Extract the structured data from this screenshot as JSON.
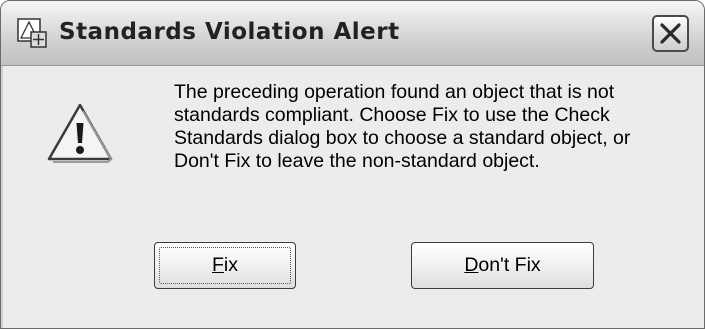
{
  "window": {
    "title": "Standards Violation Alert",
    "app_icon": "autocad-standards-icon",
    "close_icon": "close-icon"
  },
  "alert": {
    "icon": "warning-icon",
    "message_lines": [
      "The preceding operation found an object that is not",
      "standards compliant. Choose Fix to use the Check",
      "Standards dialog box to choose a standard object, or",
      "Don't Fix to leave the non-standard object."
    ]
  },
  "buttons": {
    "fix": {
      "mnemonic": "F",
      "rest": "ix"
    },
    "dont_fix": {
      "mnemonic": "D",
      "rest": "on't Fix"
    }
  },
  "colors": {
    "dialog_background": "#ececec",
    "warning_fill": "#f4f4f4",
    "warning_stroke": "#3a3a3a"
  }
}
